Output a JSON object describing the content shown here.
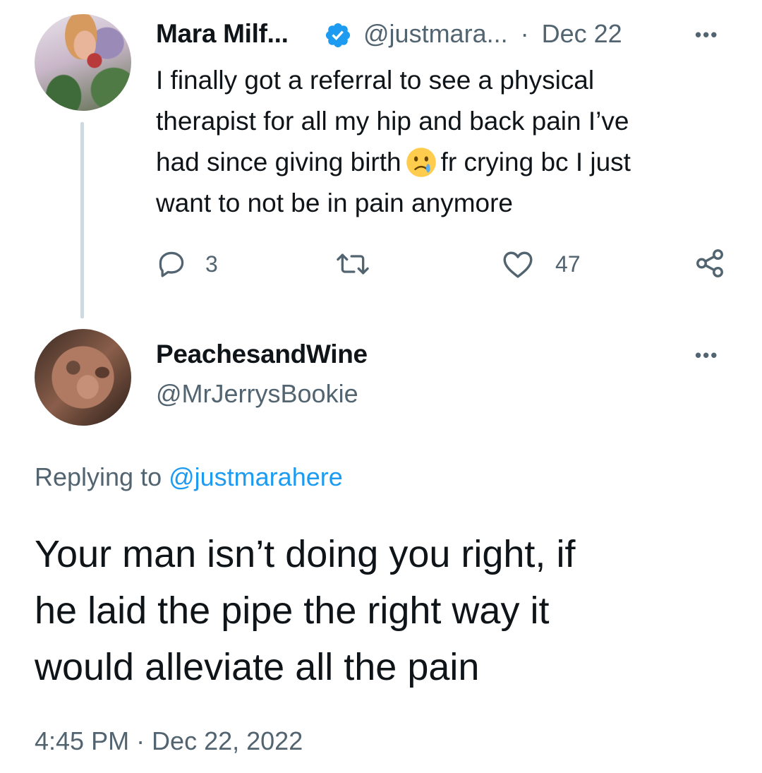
{
  "parent_tweet": {
    "display_name": "Mara Milf...",
    "handle": "@justmara...",
    "separator": "·",
    "date": "Dec 22",
    "more_label": "•••",
    "text_lines": [
      "I finally got a referral to see a physical",
      "therapist for all my hip and back pain I’ve",
      "had since giving birth",
      "fr crying bc I just",
      "want to not be in pain anymore"
    ],
    "emoji": "face-holding-back-tears",
    "actions": {
      "reply_count": "3",
      "retweet_count": "",
      "like_count": "47"
    }
  },
  "reply_tweet": {
    "display_name": "PeachesandWine",
    "handle": "@MrJerrysBookie",
    "more_label": "•••",
    "replying_prefix": "Replying to ",
    "replying_to": "@justmarahere",
    "text_lines": [
      "Your man isn’t doing you right, if",
      "he laid the pipe the right way it",
      "would alleviate all the pain"
    ],
    "timestamp": "4:45 PM · Dec 22, 2022"
  },
  "colors": {
    "text": "#0f1419",
    "secondary": "#536471",
    "accent": "#1d9bf0",
    "thread_line": "#cfd9de"
  }
}
